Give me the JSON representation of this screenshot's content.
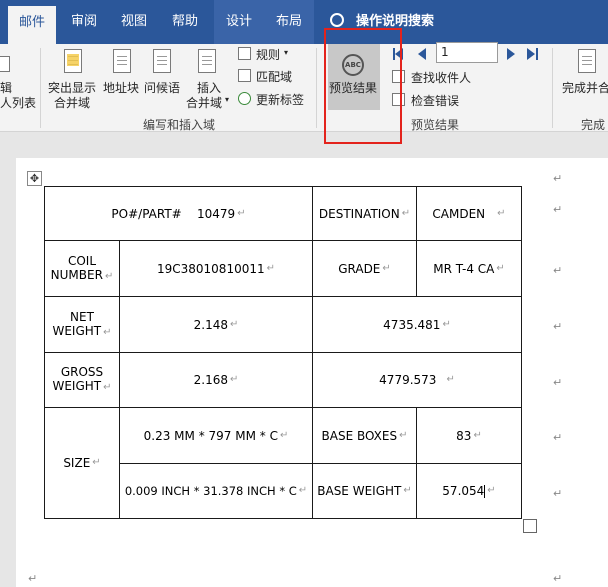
{
  "tabs": {
    "mailings": "邮件",
    "review": "审阅",
    "view": "视图",
    "help": "帮助",
    "design": "设计",
    "layout": "布局",
    "tell_me": "操作说明搜索"
  },
  "ribbon": {
    "partial_left_top": "辑",
    "partial_left_bottom": "人列表",
    "highlight_line1": "突出显示",
    "highlight_line2": "合并域",
    "address_block": "地址块",
    "greeting_line": "问候语",
    "insert_field_line1": "插入",
    "insert_field_line2": "合并域",
    "rules": "规则",
    "match_fields": "匹配域",
    "update_labels": "更新标签",
    "group_write_insert": "编写和插入域",
    "preview_results": "预览结果",
    "record_number": "1",
    "find_recipient": "查找收件人",
    "check_errors": "检查错误",
    "group_preview": "预览结果",
    "finish_merge_line1": "完成并合",
    "group_finish": "完成"
  },
  "table": {
    "po_label": "PO#/PART#",
    "po_value": "10479",
    "destination_label": "DESTINATION",
    "destination_value": "CAMDEN",
    "coil_label_1": "COIL",
    "coil_label_2": "NUMBER",
    "coil_value": "19C38010810011",
    "grade_label": "GRADE",
    "grade_value": "MR T-4 CA",
    "net_label_1": "NET",
    "net_label_2": "WEIGHT",
    "net_value": "2.148",
    "net_value_2": "4735.481",
    "gross_label_1": "GROSS",
    "gross_label_2": "WEIGHT",
    "gross_value": "2.168",
    "gross_value_2": "4779.573",
    "size_label": "SIZE",
    "size_mm": "0.23 MM * 797 MM * C",
    "size_inch": "0.009 INCH * 31.378 INCH * C",
    "base_boxes_label": "BASE BOXES",
    "base_boxes_value": "83",
    "base_weight_label": "BASE WEIGHT",
    "base_weight_value": "57.054",
    "para_mark": "↵"
  }
}
